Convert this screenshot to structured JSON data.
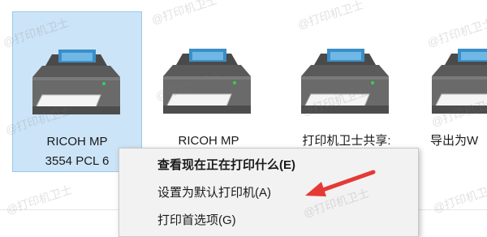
{
  "devices": [
    {
      "name_line1": "RICOH MP",
      "name_line2": "3554 PCL 6",
      "icon": "printer-icon",
      "selected": true
    },
    {
      "name_line1": "RICOH MP",
      "name_line2": "",
      "icon": "printer-icon",
      "selected": false
    },
    {
      "name_line1": "打印机卫士共享:",
      "name_line2": "",
      "icon": "printer-icon",
      "selected": false
    },
    {
      "name_line1": "导出为W",
      "name_line2": "",
      "icon": "printer-icon",
      "selected": false
    }
  ],
  "context_menu": {
    "items": [
      {
        "label": "查看现在正在打印什么(E)",
        "bold": true
      },
      {
        "label": "设置为默认打印机(A)",
        "bold": false
      },
      {
        "label": "打印首选项(G)",
        "bold": false
      }
    ]
  },
  "annotation": {
    "arrow_color": "#e53935"
  },
  "watermark": {
    "text": "@打印机卫士"
  }
}
